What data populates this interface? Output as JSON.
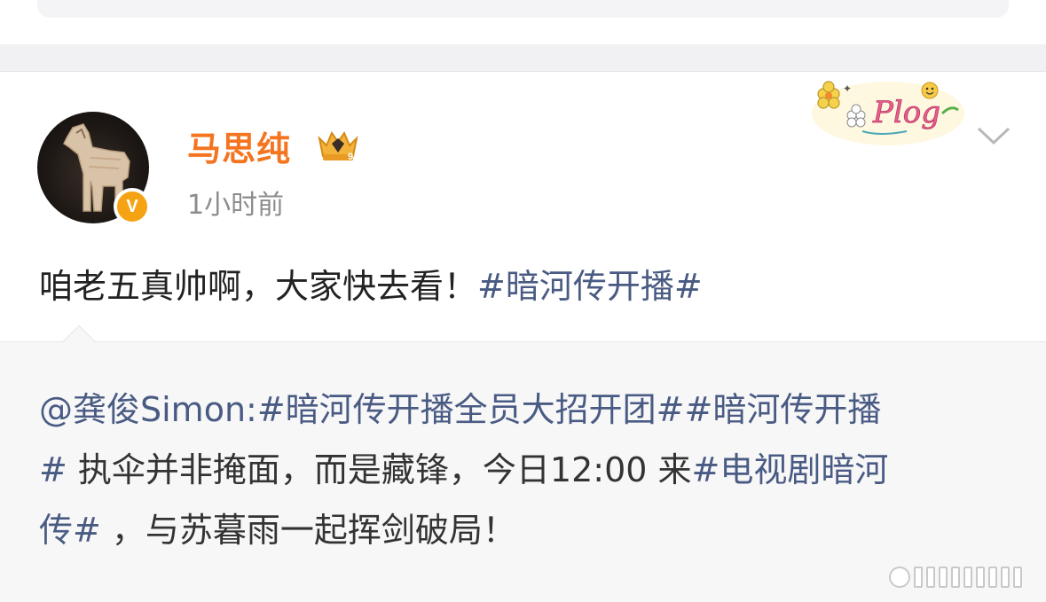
{
  "post": {
    "author": {
      "name": "马思纯",
      "time": "1小时前"
    },
    "text_plain": "咱老五真帅啊，大家快去看！",
    "text_hashtag": "#暗河传开播#"
  },
  "repost": {
    "line1_mention": "@龚俊Simon:",
    "line1_tag1": "#暗河传开播全员大招开团#",
    "line1_tag2": "#暗河传开播",
    "line2_tag_end": "#",
    "line2_text": " 执伞并非掩面，而是藏锋，今日12:00 来",
    "line2_tag": "#电视剧暗河",
    "line3_tag": "传#",
    "line3_text": " ，与苏暮雨一起挥剑破局！"
  },
  "icons": {
    "verified": "verified-v-icon",
    "crown": "crown-badge-icon",
    "sticker": "plog-sticker-icon",
    "more": "chevron-down-icon"
  },
  "colors": {
    "username": "#f5741f",
    "hashtag": "#4a5b83",
    "verified": "#f6a313"
  }
}
